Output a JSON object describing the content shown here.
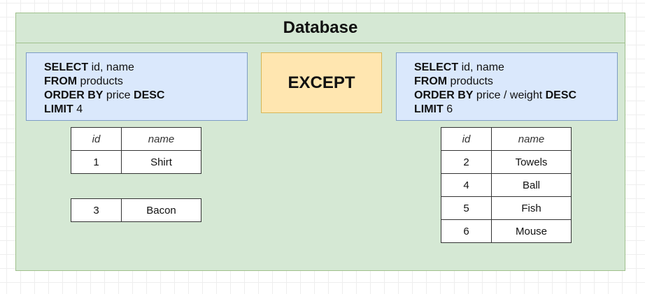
{
  "database": {
    "title": "Database"
  },
  "left_query": {
    "lines": [
      {
        "kw": "SELECT",
        "rest": " id, name",
        "kw2": ""
      },
      {
        "kw": "FROM",
        "rest": " products",
        "kw2": ""
      },
      {
        "kw": "ORDER BY",
        "rest": " price ",
        "kw2": "DESC"
      },
      {
        "kw": "LIMIT",
        "rest": " 4",
        "kw2": ""
      }
    ]
  },
  "operator": {
    "label": "EXCEPT"
  },
  "right_query": {
    "lines": [
      {
        "kw": "SELECT",
        "rest": " id, name",
        "kw2": ""
      },
      {
        "kw": "FROM",
        "rest": " products",
        "kw2": ""
      },
      {
        "kw": "ORDER BY",
        "rest": " price / weight ",
        "kw2": "DESC"
      },
      {
        "kw": "LIMIT",
        "rest": " 6",
        "kw2": ""
      }
    ]
  },
  "left_result": {
    "columns": [
      "id",
      "name"
    ],
    "rows": [
      {
        "id": "1",
        "name": "Shirt"
      },
      {
        "id": "3",
        "name": "Bacon"
      }
    ]
  },
  "right_result": {
    "columns": [
      "id",
      "name"
    ],
    "rows": [
      {
        "id": "2",
        "name": "Towels"
      },
      {
        "id": "4",
        "name": "Ball"
      },
      {
        "id": "5",
        "name": "Fish"
      },
      {
        "id": "6",
        "name": "Mouse"
      }
    ]
  }
}
